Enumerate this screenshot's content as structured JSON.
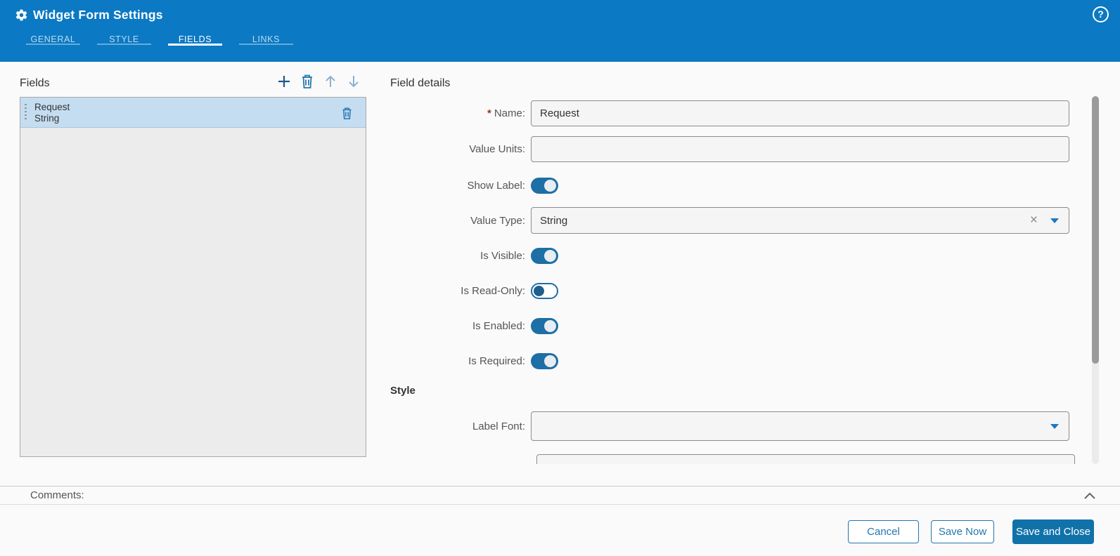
{
  "window": {
    "title": "Widget Form Settings"
  },
  "header": {
    "tabs": [
      {
        "label": "GENERAL",
        "active": false
      },
      {
        "label": "STYLE",
        "active": false
      },
      {
        "label": "FIELDS",
        "active": true
      },
      {
        "label": "LINKS",
        "active": false
      }
    ]
  },
  "glyphs": {
    "help": "?",
    "clear": "×"
  },
  "fields_panel": {
    "title": "Fields",
    "toolbar": {
      "add": "add-field",
      "delete": "delete-field",
      "move_up": "move-field-up",
      "move_down": "move-field-down"
    },
    "items": [
      {
        "name": "Request",
        "type": "String",
        "selected": true
      }
    ]
  },
  "details": {
    "title": "Field details",
    "required_marker": "*",
    "rows": {
      "name": {
        "label": "Name:",
        "required": true,
        "value": "Request"
      },
      "value_units": {
        "label": "Value Units:",
        "value": ""
      },
      "show_label": {
        "label": "Show Label:",
        "on": true
      },
      "value_type": {
        "label": "Value Type:",
        "value": "String",
        "clearable": true
      },
      "is_visible": {
        "label": "Is Visible:",
        "on": true
      },
      "is_read_only": {
        "label": "Is Read-Only:",
        "on": false
      },
      "is_enabled": {
        "label": "Is Enabled:",
        "on": true
      },
      "is_required": {
        "label": "Is Required:",
        "on": true
      }
    },
    "style_section": {
      "title": "Style",
      "label_font": {
        "label": "Label Font:",
        "value": ""
      }
    }
  },
  "comments": {
    "label": "Comments:"
  },
  "footer": {
    "cancel": "Cancel",
    "save_now": "Save Now",
    "save_and_close": "Save and Close"
  },
  "colors": {
    "header_bg": "#0b79c3",
    "accent": "#2377ae",
    "toggle_on": "#1d6fa5",
    "selected_item_bg": "#c5ddf1",
    "panel_bg": "#ececec",
    "panel_border": "#a9a9a9",
    "body_bg": "#fafafa",
    "input_bg": "#f5f5f5",
    "input_border": "#8c8c8c",
    "label_color": "#555555",
    "asterisk": "#963a20",
    "primary_button_bg": "#1172aa",
    "scroll_thumb": "#9a9a9a"
  }
}
